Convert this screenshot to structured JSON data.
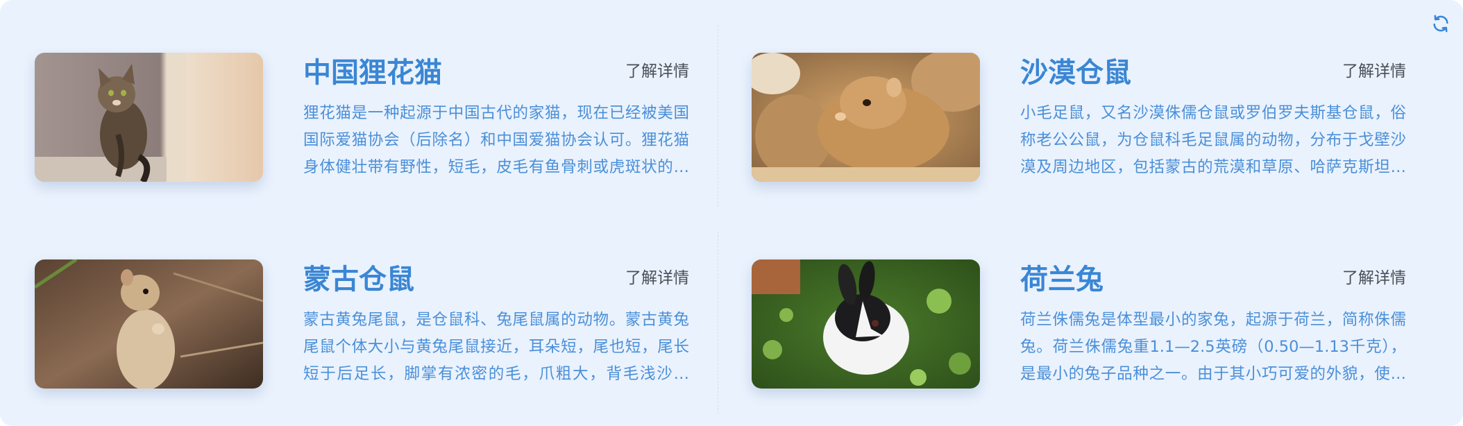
{
  "refresh_icon": "refresh-icon",
  "colors": {
    "background": "#eaf2fd",
    "title": "#3a86d4",
    "description": "#4a8fd8",
    "link": "#4a4f57"
  },
  "cards": [
    {
      "title": "中国狸花猫",
      "more": "了解详情",
      "description": "狸花猫是一种起源于中国古代的家猫，现在已经被美国国际爱猫协会（后除名）和中国爱猫协会认可。狸花猫身体健壮带有野性，短毛，皮毛有鱼骨刺或虎斑状的花纹。",
      "image": "tabby-cat-photo"
    },
    {
      "title": "沙漠仓鼠",
      "more": "了解详情",
      "description": "小毛足鼠，又名沙漠侏儒仓鼠或罗伯罗夫斯基仓鼠，俗称老公公鼠，为仓鼠科毛足鼠属的动物，分布于戈壁沙漠及周边地区，包括蒙古的荒漠和草原、哈萨克斯坦、俄罗斯等地。",
      "image": "desert-hamster-photo"
    },
    {
      "title": "蒙古仓鼠",
      "more": "了解详情",
      "description": "蒙古黄兔尾鼠，是仓鼠科、兔尾鼠属的动物。蒙古黄兔尾鼠个体大小与黄兔尾鼠接近，耳朵短，尾也短，尾长短于后足长，脚掌有浓密的毛，爪粗大，背毛浅沙黄色。",
      "image": "mongolian-gerbil-photo"
    },
    {
      "title": "荷兰兔",
      "more": "了解详情",
      "description": "荷兰侏儒兔是体型最小的家兔，起源于荷兰，简称侏儒兔。荷兰侏儒兔重1.1—2.5英磅（0.50—1.13千克），是最小的兔子品种之一。由于其小巧可爱的外貌，使得它深受人们喜爱。",
      "image": "dutch-rabbit-photo"
    }
  ]
}
